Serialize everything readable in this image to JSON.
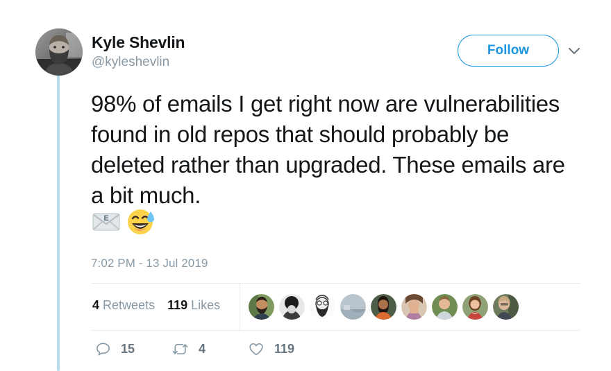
{
  "tweet": {
    "author": {
      "display_name": "Kyle Shevlin",
      "handle": "@kyleshevlin",
      "avatar_icon": "user-avatar-photo"
    },
    "follow_label": "Follow",
    "caret_icon": "chevron-down-icon",
    "text": "98% of emails I get right now are vulnerabilities found in old repos that should probably be deleted rather than upgraded. These emails are a bit much.",
    "emojis": [
      {
        "name": "email-envelope-emoji",
        "glyph": "📧"
      },
      {
        "name": "grinning-face-with-sweat-emoji",
        "glyph": "😅"
      }
    ],
    "timestamp": "7:02 PM - 13 Jul 2019",
    "stats": {
      "retweets_count": "4",
      "retweets_label": "Retweets",
      "likes_count": "119",
      "likes_label": "Likes"
    },
    "facepile": [
      {
        "name": "liker-avatar-1"
      },
      {
        "name": "liker-avatar-2"
      },
      {
        "name": "liker-avatar-3"
      },
      {
        "name": "liker-avatar-4"
      },
      {
        "name": "liker-avatar-5"
      },
      {
        "name": "liker-avatar-6"
      },
      {
        "name": "liker-avatar-7"
      },
      {
        "name": "liker-avatar-8"
      },
      {
        "name": "liker-avatar-9"
      }
    ],
    "actions": {
      "reply_count": "15",
      "retweet_count": "4",
      "like_count": "119",
      "reply_icon": "comment-icon",
      "retweet_icon": "retweet-icon",
      "like_icon": "heart-icon"
    }
  },
  "colors": {
    "accent_blue": "#1b95e0",
    "thread_line": "#b9dbee",
    "text_primary": "#14171a",
    "text_muted": "#8899a6",
    "divider": "#e6ecf0",
    "background": "#ffffff"
  }
}
